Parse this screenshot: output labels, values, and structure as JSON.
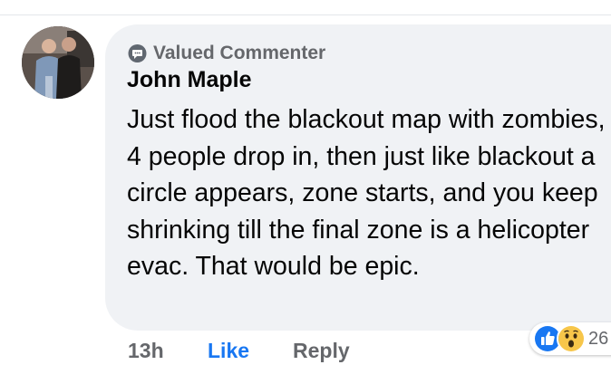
{
  "comment": {
    "badge_label": "Valued Commenter",
    "badge_icon": "speech-bubble-badge-icon",
    "author_name": "John Maple",
    "text": "Just flood the blackout map with zombies, 4 people drop in, then just like blackout a circle appears, zone starts, and you keep shrinking till the final zone is a helicopter evac. That would be epic."
  },
  "actions": {
    "timestamp": "13h",
    "like_label": "Like",
    "reply_label": "Reply"
  },
  "reactions": {
    "icons": [
      "like-icon",
      "wow-icon"
    ],
    "count": "26"
  },
  "colors": {
    "bubble_background": "#f0f2f5",
    "like_blue": "#1877f2",
    "secondary_text": "#65676b",
    "primary_text": "#050505",
    "wow_yellow": "#f7c64a"
  }
}
